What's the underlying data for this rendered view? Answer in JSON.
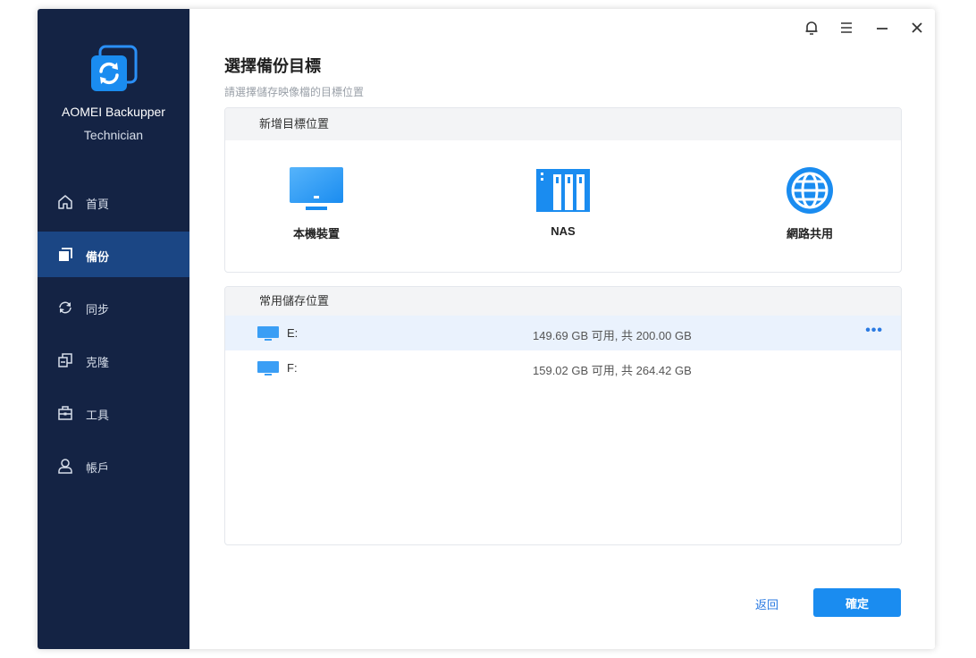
{
  "app": {
    "name": "AOMEI Backupper",
    "edition": "Technician"
  },
  "nav": {
    "items": [
      {
        "label": "首頁",
        "icon": "home-icon"
      },
      {
        "label": "備份",
        "icon": "backup-icon",
        "active": true
      },
      {
        "label": "同步",
        "icon": "sync-icon"
      },
      {
        "label": "克隆",
        "icon": "clone-icon"
      },
      {
        "label": "工具",
        "icon": "toolbox-icon"
      },
      {
        "label": "帳戶",
        "icon": "user-icon"
      }
    ]
  },
  "titlebar": {
    "icons": [
      "bell-icon",
      "menu-icon",
      "minimize-icon",
      "close-icon"
    ]
  },
  "page": {
    "title": "選擇備份目標",
    "subtitle": "請選擇儲存映像檔的目標位置"
  },
  "add_target": {
    "header": "新增目標位置",
    "options": [
      {
        "label": "本機裝置",
        "icon": "monitor-icon"
      },
      {
        "label": "NAS",
        "icon": "nas-icon"
      },
      {
        "label": "網路共用",
        "icon": "globe-icon"
      }
    ]
  },
  "common_locations": {
    "header": "常用儲存位置",
    "rows": [
      {
        "drive": "E:",
        "space": "149.69 GB 可用, 共 200.00 GB",
        "more": "•••"
      },
      {
        "drive": "F:",
        "space": "159.02 GB 可用, 共 264.42 GB"
      }
    ]
  },
  "footer": {
    "back_label": "返回",
    "confirm_label": "確定"
  },
  "colors": {
    "sidebar_bg": "#142344",
    "sidebar_active": "#1b4684",
    "accent": "#1a8cf0",
    "link": "#2a7ae2"
  }
}
